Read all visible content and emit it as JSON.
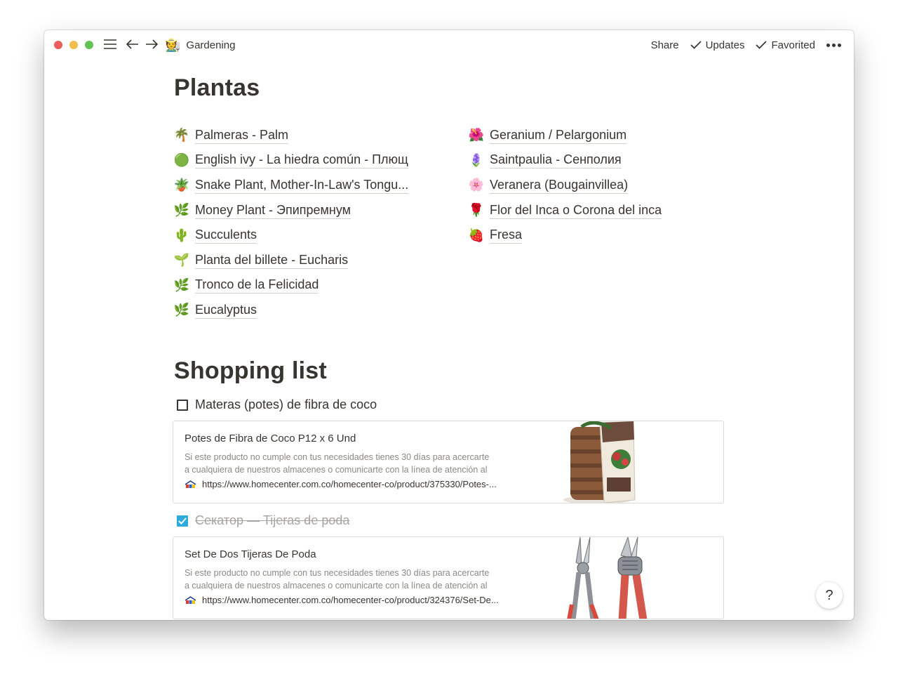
{
  "topbar": {
    "page_emoji": "🧑‍🌾",
    "page_title": "Gardening",
    "share_label": "Share",
    "updates_label": "Updates",
    "favorited_label": "Favorited"
  },
  "plantas": {
    "title": "Plantas",
    "left": [
      {
        "icon": "🌴",
        "label": "Palmeras - Palm"
      },
      {
        "icon": "🟢",
        "label": "English ivy - La hiedra común - Плющ"
      },
      {
        "icon": "🪴",
        "label": "Snake Plant, Mother-In-Law's Tongu..."
      },
      {
        "icon": "🌿",
        "label": "Money Plant - Эпипремнум"
      },
      {
        "icon": "🌵",
        "label": "Succulents"
      },
      {
        "icon": "🌱",
        "label": "Planta del billete - Eucharis"
      },
      {
        "icon": "🌿",
        "label": "Tronco de la Felicidad"
      },
      {
        "icon": "🌿",
        "label": "Eucalyptus"
      }
    ],
    "right": [
      {
        "icon": "🌺",
        "label": "Geranium / Pelargonium"
      },
      {
        "icon": "🪻",
        "label": "Saintpaulia - Сенполия"
      },
      {
        "icon": "🌸",
        "label": "Veranera (Bougainvillea)"
      },
      {
        "icon": "🌹",
        "label": "Flor del Inca o Corona del inca"
      },
      {
        "icon": "🍓",
        "label": "Fresa"
      }
    ]
  },
  "shopping": {
    "title": "Shopping list",
    "todo1": {
      "label": "Materas (potes) de fibra de coco",
      "checked": false
    },
    "bookmark1": {
      "title": "Potes de Fibra de Coco P12 x 6 Und",
      "desc_line1": "Si este producto no cumple con tus necesidades tienes 30 días para acercarte",
      "desc_line2": "a cualquiera de nuestros almacenes o comunicarte con la línea de atención al",
      "url": "https://www.homecenter.com.co/homecenter-co/product/375330/Potes-..."
    },
    "todo2": {
      "label": "Секатор — Tijeras de poda",
      "checked": true
    },
    "bookmark2": {
      "title": "Set De Dos Tijeras De Poda",
      "desc_line1": "Si este producto no cumple con tus necesidades tienes 30 días para acercarte",
      "desc_line2": "a cualquiera de nuestros almacenes o comunicarte con la línea de atención al",
      "url": "https://www.homecenter.com.co/homecenter-co/product/324376/Set-De..."
    }
  },
  "help": {
    "label": "?"
  },
  "colors": {
    "checkbox_checked": "#2eaadc",
    "text": "#37352f",
    "muted": "#8b8a85"
  }
}
